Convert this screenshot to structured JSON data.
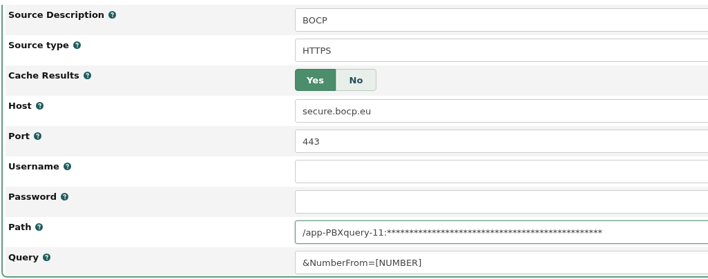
{
  "fields": [
    {
      "label": "Source Description",
      "kind": "text",
      "value": "BOCP"
    },
    {
      "label": "Source type",
      "kind": "text",
      "value": "HTTPS"
    },
    {
      "label": "Cache Results",
      "kind": "toggle",
      "options": [
        {
          "label": "Yes",
          "selected": true
        },
        {
          "label": "No",
          "selected": false
        }
      ]
    },
    {
      "label": "Host",
      "kind": "text",
      "value": "secure.bocp.eu"
    },
    {
      "label": "Port",
      "kind": "text",
      "value": "443"
    },
    {
      "label": "Username",
      "kind": "text"
    },
    {
      "label": "Password",
      "kind": "text"
    },
    {
      "label": "Path",
      "kind": "text",
      "value": "/app-PBXquery-11:************************************************",
      "focused": true
    },
    {
      "label": "Query",
      "kind": "text",
      "value": "&NumberFrom=[NUMBER]"
    }
  ]
}
